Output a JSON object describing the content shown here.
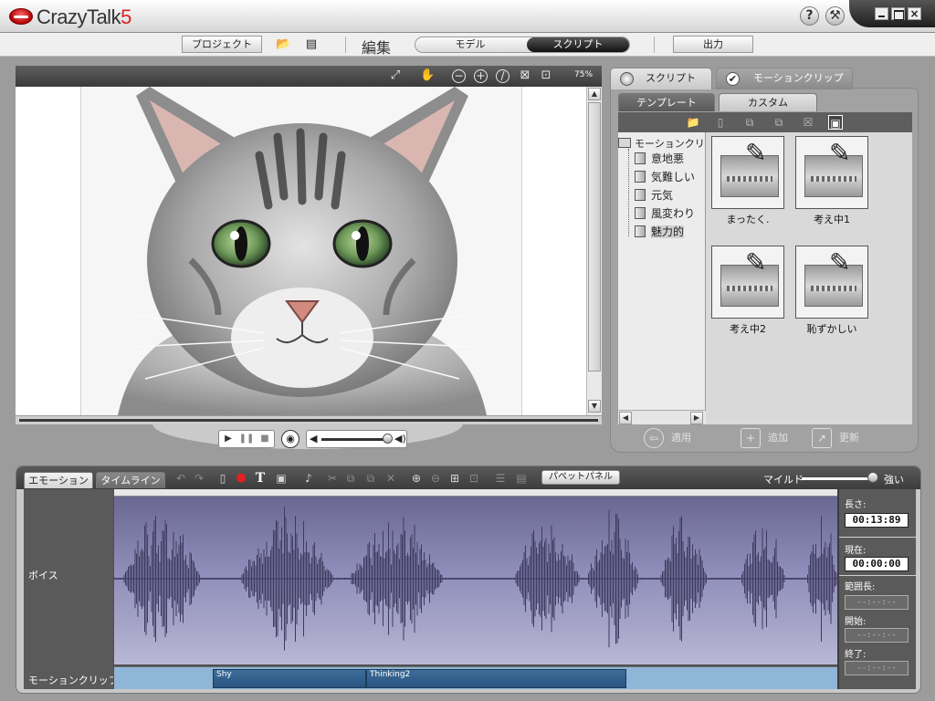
{
  "app": {
    "title_main": "CrazyTalk",
    "title_version": "5"
  },
  "titlebar": {
    "help_icon": "question-icon",
    "tools_icon": "hammer-icon",
    "minimize_icon": "minimize-icon",
    "maximize_icon": "maximize-icon",
    "close_icon": "close-icon"
  },
  "menubar": {
    "project_label": "プロジェクト",
    "open_icon": "folder-open-icon",
    "save_icon": "save-icon",
    "edit_label": "編集",
    "model_label": "モデル",
    "script_label": "スクリプト",
    "output_label": "出力"
  },
  "viewer": {
    "zoom": "75%",
    "toolbar_icons": [
      "fit-window-icon",
      "hand-pan-icon",
      "zoom-out-icon",
      "zoom-in-icon",
      "reset-icon",
      "fit-frame-icon",
      "actual-size-icon"
    ],
    "image_subject": "tabby cat portrait"
  },
  "transport": {
    "play_icon": "play-icon",
    "pause_icon": "pause-icon",
    "stop_icon": "stop-icon",
    "record_icon": "microphone-icon",
    "volume_level": 0.85
  },
  "right_panel": {
    "tabs": [
      {
        "label": "スクリプト"
      },
      {
        "label": "モーションクリップ"
      }
    ],
    "sub_tabs": [
      {
        "label": "テンプレート"
      },
      {
        "label": "カスタム"
      }
    ],
    "tree_root": "モーションクリップ",
    "tree_items": [
      "意地悪",
      "気難しい",
      "元気",
      "風変わり",
      "魅力的"
    ],
    "clips": [
      "まったく.",
      "考え中1",
      "考え中2",
      "恥ずかしい"
    ],
    "actions": {
      "apply": "適用",
      "add": "追加",
      "update": "更新"
    }
  },
  "bottom_panel": {
    "tabs": {
      "emotion": "エモーション",
      "timeline": "タイムライン"
    },
    "puppet_label": "パペットパネル",
    "mild_label": "マイルド",
    "strong_label": "強い",
    "strength_level": 0.9,
    "tracks": {
      "voice": "ボイス",
      "motion": "モーションクリップ"
    },
    "motion_clips": [
      {
        "name": "Shy"
      },
      {
        "name": "Thinking2"
      }
    ],
    "info": {
      "length_label": "長さ:",
      "length_value": "00:13:89",
      "current_label": "現在:",
      "current_value": "00:00:00",
      "range_label": "範囲長:",
      "range_value": "--:--:--",
      "start_label": "開始:",
      "start_value": "--:--:--",
      "end_label": "終了:",
      "end_value": "--:--:--"
    }
  },
  "colors": {
    "accent": "#d22222",
    "voice_lane": "#8f8eba",
    "waveform": "#3e3a60",
    "clip_bar": "#2f5c88"
  }
}
